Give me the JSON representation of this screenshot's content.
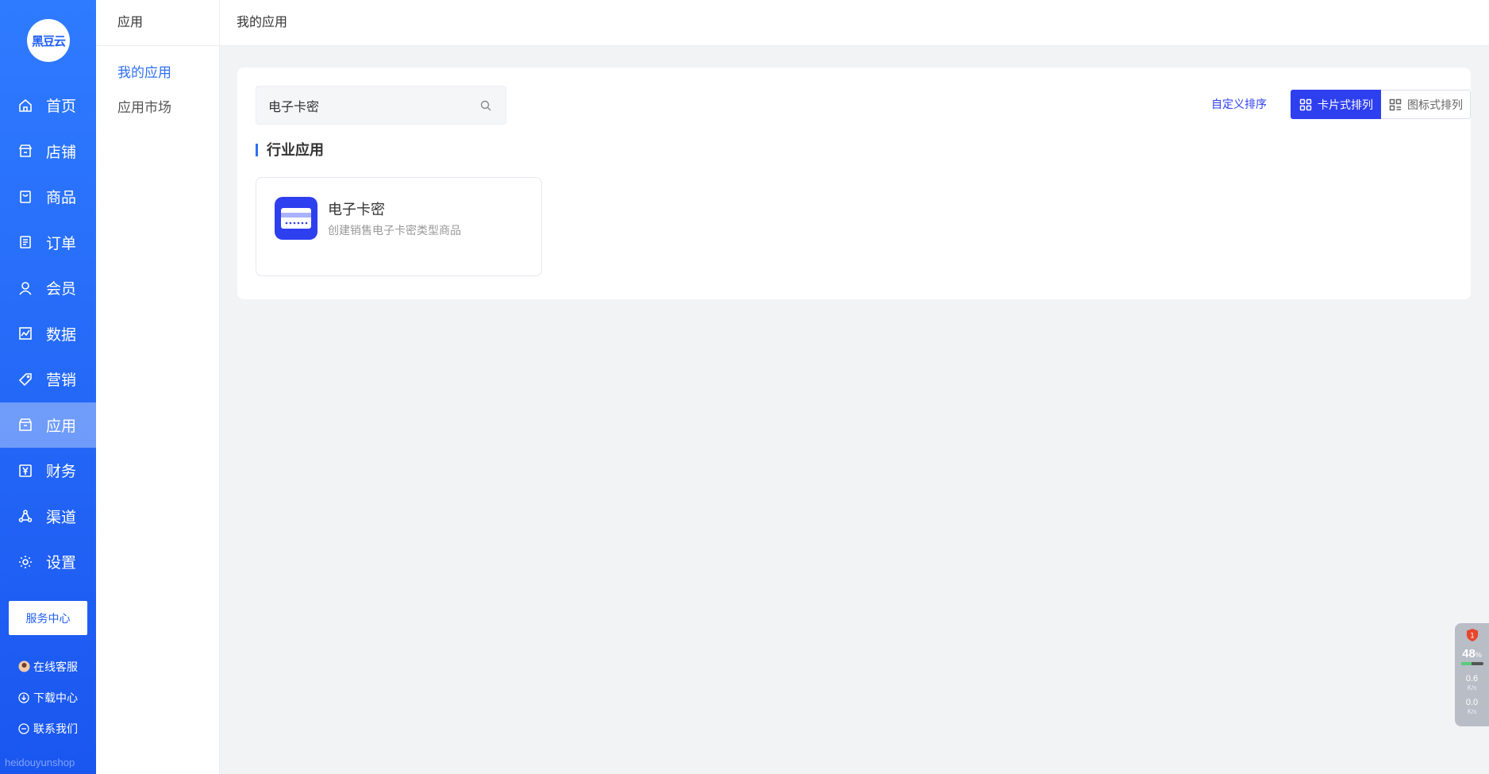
{
  "sidebar": {
    "logo_text": "黑豆云",
    "items": [
      {
        "label": "首页",
        "icon": "home-icon"
      },
      {
        "label": "店铺",
        "icon": "store-icon"
      },
      {
        "label": "商品",
        "icon": "product-icon"
      },
      {
        "label": "订单",
        "icon": "order-icon"
      },
      {
        "label": "会员",
        "icon": "user-icon"
      },
      {
        "label": "数据",
        "icon": "chart-icon"
      },
      {
        "label": "营销",
        "icon": "tag-icon"
      },
      {
        "label": "应用",
        "icon": "app-icon",
        "active": true
      },
      {
        "label": "财务",
        "icon": "yuan-icon"
      },
      {
        "label": "渠道",
        "icon": "channel-icon"
      },
      {
        "label": "设置",
        "icon": "gear-icon"
      }
    ],
    "service_center": "服务中心",
    "links": [
      {
        "label": "在线客服",
        "icon": "avatar-icon"
      },
      {
        "label": "下载中心",
        "icon": "download-icon"
      },
      {
        "label": "联系我们",
        "icon": "contact-icon"
      }
    ],
    "watermark": "heidouyunshop"
  },
  "subnav": {
    "header": "应用",
    "items": [
      {
        "label": "我的应用",
        "active": true
      },
      {
        "label": "应用市场",
        "active": false
      }
    ]
  },
  "topbar": {
    "title": "我的应用"
  },
  "main": {
    "search": {
      "value": "电子卡密"
    },
    "sort_link": "自定义排序",
    "view_card_label": "卡片式排列",
    "view_icon_label": "图标式排列",
    "section_title": "行业应用",
    "apps": [
      {
        "name": "电子卡密",
        "desc": "创建销售电子卡密类型商品",
        "icon": "card-icon"
      }
    ]
  },
  "widget": {
    "badge": "1",
    "percent": "48",
    "percent_unit": "%",
    "usage_fraction": 0.48,
    "up_speed": "0.6",
    "down_speed": "0.0",
    "speed_unit": "K/s"
  },
  "colors": {
    "primary": "#2e3ff0",
    "sidebar": "#1f5ef5",
    "accent_blue": "#2e6ff2"
  }
}
